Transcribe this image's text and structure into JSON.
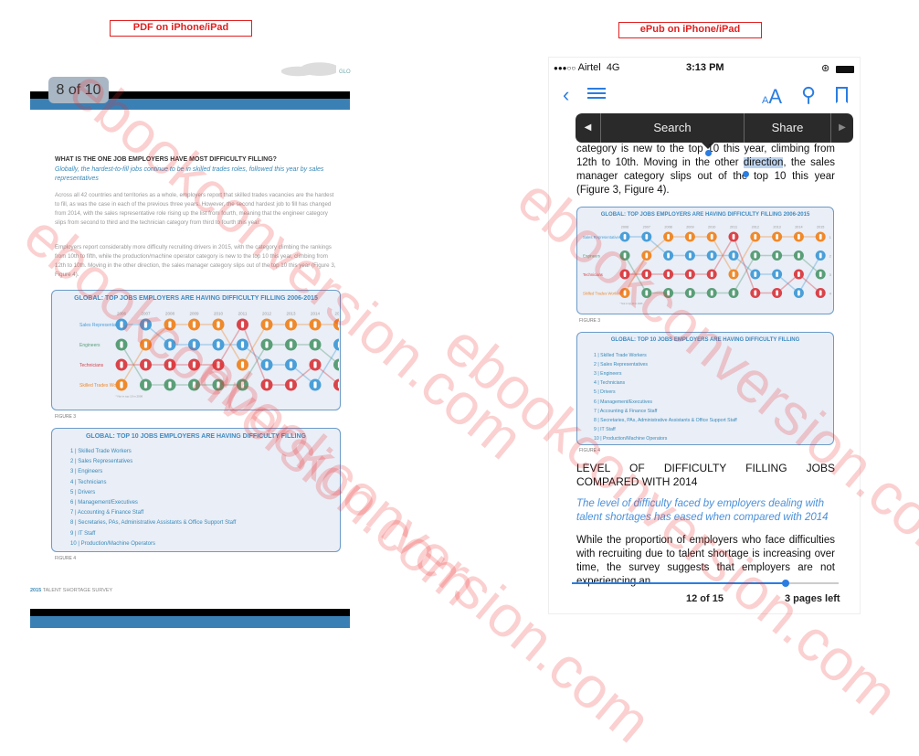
{
  "labels": {
    "pdf": "PDF on iPhone/iPad",
    "epub": "ePub on iPhone/iPad"
  },
  "pdf": {
    "page_indicator": "8 of 10",
    "header_code": "GLO",
    "heading": "WHAT IS THE ONE JOB EMPLOYERS HAVE MOST DIFFICULTY FILLING?",
    "intro": "Globally, the hardest-to-fill jobs continue to be in skilled trades roles, followed this year by sales representatives",
    "para1": "Across all 42 countries and territories as a whole, employers report that skilled trades vacancies are the hardest to fill, as was the case in each of the previous three years. However, the second hardest job to fill has changed from 2014, with the sales representative role rising up the list from fourth, meaning that the engineer category slips from second to third and the technician category from third to fourth this year.",
    "para2": "Employers report considerably more difficulty recruiting drivers in 2015, with the category climbing the rankings from 10th to fifth, while the production/machine operator category is new to the top 10 this year, climbing from 12th to 10th. Moving in the other direction, the sales manager category slips out of the top 10 this year (Figure 3, Figure 4).",
    "figure3": "FIGURE 3",
    "figure4": "FIGURE 4",
    "footer_year": "2015",
    "footer_text": "TALENT SHORTAGE SURVEY"
  },
  "chart_data": {
    "type": "table",
    "title": "GLOBAL: TOP JOBS EMPLOYERS ARE HAVING DIFFICULTY FILLING 2006-2015",
    "years": [
      "2006",
      "2007",
      "2008",
      "2009",
      "2010",
      "2011",
      "2012",
      "2013",
      "2014",
      "2015"
    ],
    "row_labels": [
      "Sales Representatives",
      "Engineers",
      "Technicians",
      "Skilled Trades Workers"
    ],
    "ranks": [
      "1",
      "2",
      "3",
      "4"
    ],
    "categories": {
      "S": {
        "name": "Sales Representatives",
        "color": "#4a9fd8"
      },
      "E": {
        "name": "Engineers",
        "color": "#5a9e78"
      },
      "T": {
        "name": "Technicians",
        "color": "#d9444a"
      },
      "W": {
        "name": "Skilled Trades Workers",
        "color": "#ef8a2c"
      }
    },
    "ranking_by_year": [
      [
        "S",
        "E",
        "T",
        "W"
      ],
      [
        "S",
        "W",
        "T",
        "E"
      ],
      [
        "W",
        "S",
        "T",
        "E"
      ],
      [
        "W",
        "S",
        "T",
        "E"
      ],
      [
        "W",
        "S",
        "T",
        "E"
      ],
      [
        "T",
        "S",
        "W",
        "E"
      ],
      [
        "W",
        "E",
        "S",
        "T"
      ],
      [
        "W",
        "E",
        "S",
        "T"
      ],
      [
        "W",
        "E",
        "T",
        "S"
      ],
      [
        "W",
        "S",
        "E",
        "T"
      ]
    ],
    "footnote": "* Not in top 10 in 2006"
  },
  "top10": {
    "title": "GLOBAL: TOP 10 JOBS EMPLOYERS ARE HAVING DIFFICULTY FILLING",
    "items": [
      "Skilled Trade Workers",
      "Sales Representatives",
      "Engineers",
      "Technicians",
      "Drivers",
      "Management/Executives",
      "Accounting & Finance Staff",
      "Secretaries, PAs, Administrative Assistants & Office Support Staff",
      "IT Staff",
      "Production/Machine Operators"
    ]
  },
  "epub": {
    "status": {
      "signal": "●●●○○",
      "carrier": "Airtel",
      "network": "4G",
      "time": "3:13 PM"
    },
    "menu": {
      "search": "Search",
      "share": "Share"
    },
    "text_before": "category is new to the top 10 this year, climbing from 12th to 10th. Moving in the other ",
    "selected": "direction",
    "text_after": ", the sales manager category slips out of the top 10 this year (Figure 3, Figure 4).",
    "figure3": "FIGURE 3",
    "figure4": "FIGURE 4",
    "heading": "LEVEL OF DIFFICULTY FILLING JOBS COMPARED WITH 2014",
    "intro": "The level of difficulty faced by employers dealing with talent shortages has eased when compared with 2014",
    "body": "While the proportion of employers who face difficulties with recruiting due to talent shortage is increasing over time, the survey suggests that employers are not experiencing an",
    "progress": 0.8,
    "page": "12 of 15",
    "pages_left": "3 pages left",
    "accent": "#2a7de1"
  },
  "watermark": "ebookconversion.com"
}
